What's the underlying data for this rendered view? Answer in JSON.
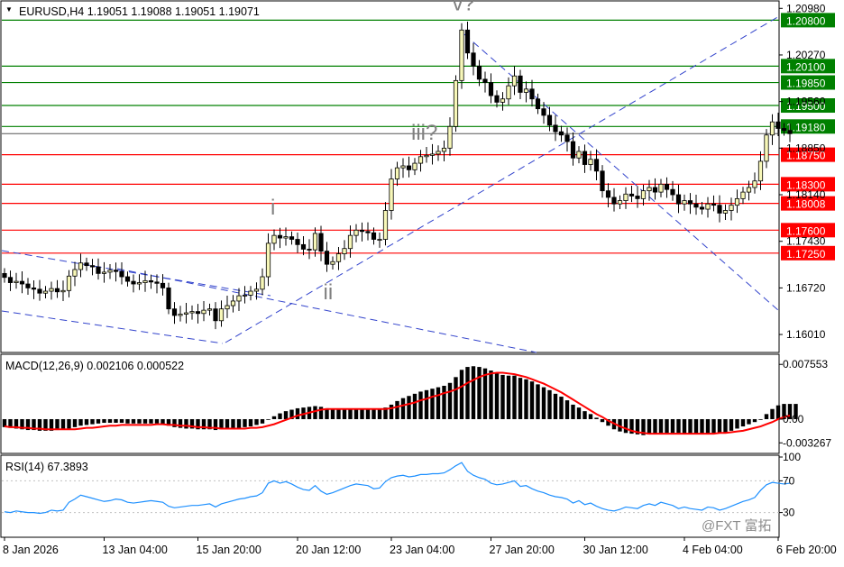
{
  "symbol_header": "EURUSD,H4  1.19051 1.19088 1.19051 1.19071",
  "macd_header": "MACD(12,26,9) 0.002106 0.000522",
  "rsi_header": "RSI(14) 67.3893",
  "watermark": "@FXT 富拓",
  "colors": {
    "bull_candle": "#f7f7b8",
    "bear_candle": "#000000",
    "resistance": "#008000",
    "support": "#ff0000",
    "trendline": "#3344cc",
    "macd_signal": "#ff0000",
    "rsi_line": "#1e90ff",
    "grid": "#c0c0c0"
  },
  "chart_data": [
    {
      "type": "candlestick",
      "panel": "price",
      "y_ticks": [
        "1.20980",
        "1.20270",
        "1.19560",
        "1.18850",
        "1.18140",
        "1.17430",
        "1.16720",
        "1.16010"
      ],
      "ylim": [
        1.1575,
        1.2108
      ],
      "levels": [
        {
          "value": "1.20800",
          "kind": "resistance"
        },
        {
          "value": "1.20100",
          "kind": "resistance"
        },
        {
          "value": "1.19850",
          "kind": "resistance"
        },
        {
          "value": "1.19500",
          "kind": "resistance"
        },
        {
          "value": "1.19180",
          "kind": "resistance"
        },
        {
          "value": "1.18750",
          "kind": "support"
        },
        {
          "value": "1.18300",
          "kind": "support"
        },
        {
          "value": "1.18008",
          "kind": "support"
        },
        {
          "value": "1.17600",
          "kind": "support"
        },
        {
          "value": "1.17250",
          "kind": "support"
        }
      ],
      "current_price": 1.19071,
      "wave_labels": [
        {
          "text": "i",
          "bar": 46,
          "price": 1.1784
        },
        {
          "text": "ii",
          "bar": 55,
          "price": 1.1655
        },
        {
          "text": "iii?",
          "bar": 70,
          "price": 1.1898
        },
        {
          "text": "v?",
          "bar": 77,
          "price": 1.2095
        }
      ],
      "close": [
        1.1688,
        1.168,
        1.1682,
        1.1678,
        1.1672,
        1.167,
        1.1664,
        1.1667,
        1.1671,
        1.1666,
        1.1668,
        1.169,
        1.17,
        1.171,
        1.1706,
        1.1704,
        1.1694,
        1.1696,
        1.1699,
        1.1697,
        1.1689,
        1.1682,
        1.1678,
        1.168,
        1.1683,
        1.1681,
        1.1679,
        1.1672,
        1.164,
        1.163,
        1.1632,
        1.1634,
        1.1636,
        1.1633,
        1.1638,
        1.164,
        1.1622,
        1.164,
        1.1645,
        1.1652,
        1.166,
        1.1661,
        1.1667,
        1.167,
        1.1689,
        1.174,
        1.1752,
        1.1748,
        1.175,
        1.1746,
        1.1738,
        1.1731,
        1.173,
        1.1755,
        1.1728,
        1.1708,
        1.1712,
        1.1724,
        1.1732,
        1.1752,
        1.176,
        1.1758,
        1.1756,
        1.1746,
        1.1746,
        1.179,
        1.1838,
        1.1855,
        1.1858,
        1.1852,
        1.1862,
        1.1872,
        1.1874,
        1.1876,
        1.188,
        1.1885,
        1.1918,
        1.1988,
        1.2065,
        1.203,
        1.201,
        1.199,
        1.1985,
        1.1965,
        1.1955,
        1.196,
        1.198,
        1.1995,
        1.197,
        1.1975,
        1.196,
        1.1945,
        1.1935,
        1.192,
        1.191,
        1.1905,
        1.1895,
        1.187,
        1.188,
        1.186,
        1.1868,
        1.185,
        1.182,
        1.181,
        1.18,
        1.1805,
        1.1815,
        1.1812,
        1.1808,
        1.182,
        1.1825,
        1.1818,
        1.183,
        1.1822,
        1.1814,
        1.18,
        1.1805,
        1.18,
        1.1795,
        1.1792,
        1.18,
        1.1798,
        1.1786,
        1.179,
        1.1798,
        1.1808,
        1.1818,
        1.1825,
        1.1835,
        1.1865,
        1.1905,
        1.1925,
        1.1915,
        1.1912,
        1.1907
      ]
    },
    {
      "type": "bar",
      "panel": "macd",
      "y_ticks": [
        "0.007553",
        "0.00",
        "-0.003267"
      ],
      "ylim": [
        -0.0046,
        0.0087
      ],
      "histogram": [
        -0.0011,
        -0.0012,
        -0.0013,
        -0.0014,
        -0.0015,
        -0.0015,
        -0.0016,
        -0.0016,
        -0.0016,
        -0.0015,
        -0.0014,
        -0.0013,
        -0.0011,
        -0.0009,
        -0.0008,
        -0.0007,
        -0.0006,
        -0.0005,
        -0.0005,
        -0.0005,
        -0.0005,
        -0.0006,
        -0.0006,
        -0.0006,
        -0.0006,
        -0.0006,
        -0.0006,
        -0.0007,
        -0.0009,
        -0.0011,
        -0.0012,
        -0.0013,
        -0.0013,
        -0.0014,
        -0.0014,
        -0.0014,
        -0.0015,
        -0.0014,
        -0.0014,
        -0.0013,
        -0.0012,
        -0.0011,
        -0.001,
        -0.0008,
        -0.0006,
        -0.0001,
        0.0004,
        0.0008,
        0.0011,
        0.0013,
        0.0015,
        0.0016,
        0.0017,
        0.0018,
        0.0017,
        0.0015,
        0.0014,
        0.0013,
        0.0013,
        0.0014,
        0.0014,
        0.0014,
        0.0014,
        0.0013,
        0.0013,
        0.0016,
        0.002,
        0.0025,
        0.0029,
        0.0032,
        0.0035,
        0.0038,
        0.004,
        0.0042,
        0.0044,
        0.0046,
        0.005,
        0.0058,
        0.0068,
        0.0072,
        0.0073,
        0.0072,
        0.007,
        0.0067,
        0.0064,
        0.0061,
        0.006,
        0.006,
        0.0057,
        0.0055,
        0.0052,
        0.0048,
        0.0044,
        0.004,
        0.0035,
        0.0031,
        0.0026,
        0.002,
        0.0016,
        0.0011,
        0.0007,
        0.0002,
        -0.0004,
        -0.0009,
        -0.0014,
        -0.0017,
        -0.0019,
        -0.002,
        -0.0021,
        -0.0022,
        -0.0021,
        -0.002,
        -0.0019,
        -0.0019,
        -0.0019,
        -0.0019,
        -0.002,
        -0.002,
        -0.002,
        -0.002,
        -0.002,
        -0.0019,
        -0.0018,
        -0.0018,
        -0.0016,
        -0.0013,
        -0.001,
        -0.0007,
        -0.0004,
        0.0,
        0.0007,
        0.0014,
        0.0019,
        0.0021,
        0.0021,
        0.0021
      ],
      "signal": [
        -0.001,
        -0.0011,
        -0.0011,
        -0.0012,
        -0.0012,
        -0.0013,
        -0.0013,
        -0.0014,
        -0.0014,
        -0.0014,
        -0.0014,
        -0.0014,
        -0.0014,
        -0.0013,
        -0.0012,
        -0.0012,
        -0.0011,
        -0.001,
        -0.0009,
        -0.0009,
        -0.0008,
        -0.0008,
        -0.0008,
        -0.0008,
        -0.0008,
        -0.0008,
        -0.0007,
        -0.0007,
        -0.0008,
        -0.0008,
        -0.0009,
        -0.0009,
        -0.001,
        -0.0011,
        -0.0011,
        -0.0012,
        -0.0012,
        -0.0013,
        -0.0013,
        -0.0013,
        -0.0013,
        -0.0013,
        -0.0012,
        -0.0012,
        -0.0011,
        -0.0009,
        -0.0007,
        -0.0004,
        -0.0001,
        0.0002,
        0.0005,
        0.0007,
        0.0009,
        0.0011,
        0.0013,
        0.0014,
        0.0014,
        0.0014,
        0.0014,
        0.0014,
        0.0014,
        0.0014,
        0.0014,
        0.0014,
        0.0014,
        0.0014,
        0.0015,
        0.0017,
        0.0019,
        0.0021,
        0.0023,
        0.0026,
        0.0028,
        0.0031,
        0.0033,
        0.0036,
        0.0038,
        0.0041,
        0.0045,
        0.005,
        0.0054,
        0.0058,
        0.0061,
        0.0063,
        0.0064,
        0.0064,
        0.0063,
        0.0062,
        0.006,
        0.0058,
        0.0055,
        0.0052,
        0.0049,
        0.0045,
        0.0041,
        0.0037,
        0.0032,
        0.0027,
        0.0022,
        0.0017,
        0.0012,
        0.0007,
        0.0003,
        -0.0002,
        -0.0006,
        -0.001,
        -0.0013,
        -0.0016,
        -0.0018,
        -0.0019,
        -0.002,
        -0.002,
        -0.002,
        -0.002,
        -0.002,
        -0.002,
        -0.002,
        -0.002,
        -0.002,
        -0.002,
        -0.002,
        -0.002,
        -0.0019,
        -0.0019,
        -0.0018,
        -0.0017,
        -0.0016,
        -0.0014,
        -0.0012,
        -0.001,
        -0.0007,
        -0.0004,
        0.0,
        0.0003,
        0.0005
      ]
    },
    {
      "type": "line",
      "panel": "rsi",
      "y_ticks": [
        "100",
        "70",
        "30",
        "0"
      ],
      "levels": [
        70,
        30
      ],
      "ylim": [
        0,
        100
      ],
      "values": [
        31,
        30,
        32,
        31,
        30,
        30,
        29,
        30,
        33,
        32,
        33,
        43,
        47,
        52,
        50,
        48,
        46,
        44,
        45,
        47,
        46,
        43,
        42,
        43,
        44,
        45,
        44,
        43,
        38,
        36,
        37,
        38,
        39,
        39,
        40,
        41,
        37,
        41,
        43,
        45,
        47,
        48,
        50,
        51,
        55,
        67,
        70,
        67,
        69,
        66,
        62,
        59,
        58,
        64,
        57,
        53,
        55,
        58,
        61,
        64,
        66,
        65,
        64,
        60,
        61,
        69,
        74,
        76,
        77,
        75,
        76,
        78,
        78,
        79,
        79,
        80,
        84,
        89,
        93,
        82,
        77,
        74,
        72,
        67,
        65,
        66,
        68,
        70,
        63,
        64,
        60,
        57,
        55,
        52,
        50,
        49,
        47,
        42,
        45,
        40,
        42,
        38,
        35,
        33,
        32,
        34,
        37,
        36,
        35,
        39,
        41,
        39,
        43,
        41,
        39,
        35,
        37,
        35,
        34,
        33,
        37,
        36,
        33,
        35,
        38,
        41,
        44,
        46,
        49,
        58,
        65,
        68,
        67,
        66,
        67
      ],
      "note": "dotted reference lines at 70 and 30"
    }
  ],
  "x_labels": [
    "8 Jan 2026",
    "13 Jan 04:00",
    "15 Jan 20:00",
    "20 Jan 12:00",
    "23 Jan 04:00",
    "27 Jan 20:00",
    "30 Jan 12:00",
    "4 Feb 04:00",
    "6 Feb 20:00"
  ],
  "x_label_bars": [
    0,
    17,
    33,
    50,
    66,
    83,
    99,
    116,
    132
  ]
}
